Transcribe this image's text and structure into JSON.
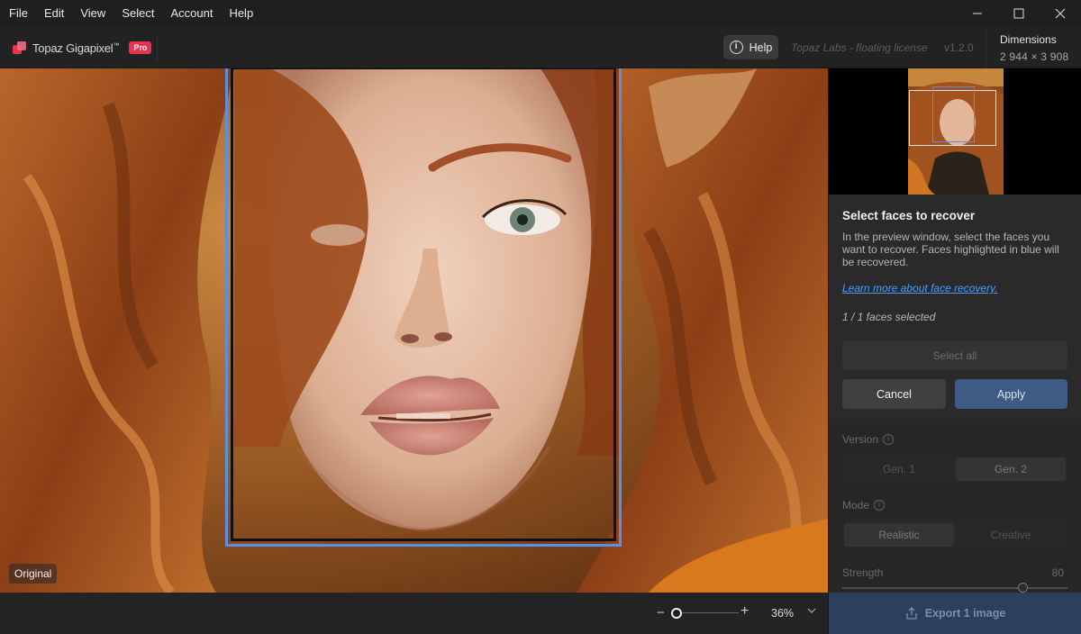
{
  "menu": [
    "File",
    "Edit",
    "View",
    "Select",
    "Account",
    "Help"
  ],
  "window_controls": {
    "minimize": "minimize-icon",
    "maximize": "maximize-icon",
    "close": "close-icon"
  },
  "header": {
    "app_name": "Topaz Gigapixel",
    "trademark": "™",
    "badge": "Pro",
    "help_label": "Help",
    "license": "Topaz Labs - floating license",
    "version": "v1.2.0",
    "dimensions_label": "Dimensions",
    "dimensions_value": "2 944 × 3 908"
  },
  "preview": {
    "mode_label": "Original",
    "face_box_color": "#5b8ee6"
  },
  "zoom": {
    "minus": "−",
    "plus": "+",
    "value": "36%",
    "level": 0.08
  },
  "recover": {
    "title": "Select faces to recover",
    "description": "In the preview window, select the faces you want to recover. Faces highlighted in blue will be recovered.",
    "link": "Learn more about face recovery.",
    "count": "1 / 1 faces selected",
    "select_all": "Select all",
    "cancel": "Cancel",
    "apply": "Apply"
  },
  "settings": {
    "version_label": "Version",
    "versions": [
      "Gen. 1",
      "Gen. 2"
    ],
    "version_selected": "Gen. 2",
    "mode_label": "Mode",
    "modes": [
      "Realistic",
      "Creative"
    ],
    "mode_selected": "Realistic",
    "strength_label": "Strength",
    "strength_value": "80",
    "strength_level": 0.8
  },
  "export_label": "Export 1 image",
  "colors": {
    "accent": "#e8334f",
    "apply": "#3e5b86",
    "link": "#4b9bff",
    "export": "#2c3f5c"
  }
}
